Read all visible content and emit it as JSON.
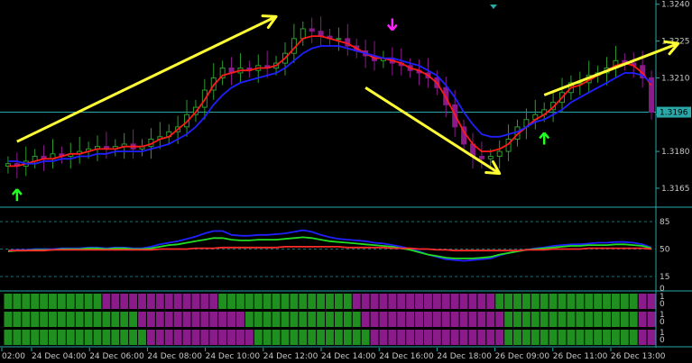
{
  "colors": {
    "background": "#000000",
    "axis": "#2aa8a8",
    "grid": "#1e6e6e",
    "tick_text": "#c8c8c8",
    "candle_up": "#2e9b2e",
    "candle_down": "#8b1a8b",
    "ma_fast": "#ff1a1a",
    "ma_slow": "#2020ff",
    "rsi_fast": "#2020ff",
    "rsi_mid": "#22dd22",
    "rsi_slow": "#ff2a2a",
    "arrow_trend": "#ffff33",
    "signal_up": "#22ff22",
    "signal_down": "#ff22ff",
    "current_price_box": "#2aa8a8",
    "bar_green": "#1f8f1f",
    "bar_purple": "#8b1a8b"
  },
  "chart_data": [
    {
      "type": "candlestick",
      "panel": "price",
      "ylim": [
        1.3158,
        1.3241
      ],
      "y_ticks": [
        "1.3240",
        "1.3225",
        "1.3210",
        "1.3195",
        "1.3180",
        "1.3165"
      ],
      "current_price_label": "1.3196",
      "x_ticks": [
        "02:00",
        "24 Dec 04:00",
        "24 Dec 06:00",
        "24 Dec 08:00",
        "24 Dec 10:00",
        "24 Dec 12:00",
        "24 Dec 14:00",
        "24 Dec 16:00",
        "24 Dec 18:00",
        "26 Dec 09:00",
        "26 Dec 11:00",
        "26 Dec 13:00"
      ],
      "series": [
        {
          "name": "close",
          "values": [
            1.3175,
            1.3174,
            1.3176,
            1.3178,
            1.3177,
            1.3179,
            1.3178,
            1.3179,
            1.318,
            1.3181,
            1.3182,
            1.3181,
            1.3182,
            1.3183,
            1.3181,
            1.3182,
            1.3185,
            1.3186,
            1.3188,
            1.319,
            1.3195,
            1.3198,
            1.3205,
            1.321,
            1.3214,
            1.3212,
            1.3214,
            1.3213,
            1.3215,
            1.3214,
            1.3216,
            1.322,
            1.3226,
            1.323,
            1.3229,
            1.3227,
            1.3226,
            1.3226,
            1.3223,
            1.3221,
            1.3219,
            1.3217,
            1.3218,
            1.3216,
            1.3215,
            1.3213,
            1.3212,
            1.321,
            1.3206,
            1.3199,
            1.319,
            1.3183,
            1.3178,
            1.3177,
            1.3178,
            1.318,
            1.3185,
            1.319,
            1.3193,
            1.3195,
            1.3197,
            1.32,
            1.3204,
            1.3208,
            1.3208,
            1.3211,
            1.3212,
            1.3214,
            1.3217,
            1.3216,
            1.3215,
            1.321,
            1.3196
          ]
        },
        {
          "name": "ma_fast",
          "values": [
            1.3174,
            1.3174,
            1.3175,
            1.3176,
            1.3177,
            1.3177,
            1.3178,
            1.3179,
            1.3179,
            1.318,
            1.3181,
            1.3181,
            1.3181,
            1.3182,
            1.3182,
            1.3182,
            1.3183,
            1.3185,
            1.3186,
            1.3189,
            1.3192,
            1.3196,
            1.3201,
            1.3207,
            1.3211,
            1.3212,
            1.3213,
            1.3213,
            1.3214,
            1.3214,
            1.3215,
            1.3218,
            1.3222,
            1.3226,
            1.3227,
            1.3227,
            1.3226,
            1.3225,
            1.3224,
            1.3222,
            1.322,
            1.3218,
            1.3218,
            1.3217,
            1.3216,
            1.3214,
            1.3213,
            1.3211,
            1.3208,
            1.3202,
            1.3195,
            1.3188,
            1.3183,
            1.318,
            1.318,
            1.3181,
            1.3183,
            1.3187,
            1.319,
            1.3193,
            1.3195,
            1.3198,
            1.3202,
            1.3206,
            1.3207,
            1.3209,
            1.3211,
            1.3213,
            1.3215,
            1.3216,
            1.3215,
            1.3212,
            1.3207
          ]
        },
        {
          "name": "ma_slow",
          "values": [
            1.3176,
            1.3176,
            1.3175,
            1.3175,
            1.3176,
            1.3176,
            1.3177,
            1.3177,
            1.3178,
            1.3178,
            1.3179,
            1.3179,
            1.318,
            1.318,
            1.318,
            1.318,
            1.3181,
            1.3182,
            1.3183,
            1.3185,
            1.3187,
            1.319,
            1.3194,
            1.3199,
            1.3203,
            1.3206,
            1.3208,
            1.3209,
            1.321,
            1.3211,
            1.3212,
            1.3214,
            1.3217,
            1.322,
            1.3222,
            1.3223,
            1.3223,
            1.3223,
            1.3222,
            1.3221,
            1.322,
            1.3219,
            1.3218,
            1.3218,
            1.3217,
            1.3216,
            1.3215,
            1.3213,
            1.3211,
            1.3207,
            1.3202,
            1.3196,
            1.3191,
            1.3187,
            1.3186,
            1.3186,
            1.3187,
            1.3188,
            1.319,
            1.3192,
            1.3193,
            1.3195,
            1.3197,
            1.32,
            1.3202,
            1.3204,
            1.3206,
            1.3208,
            1.321,
            1.3212,
            1.3212,
            1.3211,
            1.3208
          ]
        }
      ],
      "trend_arrows": [
        {
          "from": [
            1,
            1.3184
          ],
          "to": [
            30,
            1.3235
          ]
        },
        {
          "from": [
            40,
            1.3206
          ],
          "to": [
            55,
            1.3171
          ]
        },
        {
          "from": [
            60,
            1.3203
          ],
          "to": [
            75,
            1.3224
          ]
        }
      ],
      "signals": [
        {
          "dir": "up",
          "i": 1
        },
        {
          "dir": "down",
          "i": 43
        },
        {
          "dir": "up",
          "i": 60
        },
        {
          "dir": "down",
          "i": 73
        }
      ]
    },
    {
      "type": "line",
      "panel": "oscillator",
      "ylim": [
        0,
        100
      ],
      "y_ticks": [
        "85",
        "50",
        "15",
        "0"
      ],
      "dashed_levels": [
        85,
        50,
        15
      ],
      "series": [
        {
          "name": "fast",
          "values": [
            48,
            49,
            49,
            50,
            50,
            50,
            51,
            51,
            51,
            52,
            52,
            51,
            52,
            52,
            51,
            51,
            53,
            56,
            58,
            60,
            63,
            66,
            70,
            73,
            73,
            68,
            67,
            67,
            68,
            68,
            69,
            70,
            72,
            74,
            72,
            68,
            65,
            63,
            62,
            61,
            60,
            58,
            57,
            55,
            53,
            50,
            47,
            43,
            40,
            37,
            36,
            35,
            36,
            37,
            38,
            42,
            45,
            47,
            49,
            51,
            52,
            54,
            55,
            56,
            56,
            57,
            58,
            58,
            59,
            59,
            58,
            56,
            52
          ]
        },
        {
          "name": "mid",
          "values": [
            47,
            48,
            48,
            49,
            49,
            49,
            50,
            50,
            50,
            51,
            51,
            50,
            51,
            51,
            50,
            50,
            51,
            53,
            55,
            56,
            58,
            60,
            62,
            64,
            64,
            62,
            61,
            61,
            62,
            62,
            62,
            63,
            64,
            65,
            64,
            62,
            60,
            59,
            58,
            57,
            56,
            55,
            54,
            53,
            51,
            49,
            46,
            43,
            41,
            39,
            38,
            38,
            38,
            39,
            40,
            43,
            45,
            47,
            49,
            50,
            51,
            52,
            53,
            54,
            54,
            55,
            55,
            55,
            56,
            56,
            55,
            54,
            51
          ]
        },
        {
          "name": "slow",
          "values": [
            48,
            48,
            48,
            48,
            48,
            49,
            49,
            49,
            49,
            49,
            49,
            49,
            49,
            49,
            49,
            49,
            49,
            50,
            50,
            50,
            50,
            51,
            51,
            51,
            52,
            52,
            52,
            52,
            52,
            52,
            52,
            53,
            53,
            53,
            53,
            53,
            53,
            53,
            52,
            52,
            52,
            52,
            52,
            51,
            51,
            51,
            50,
            50,
            49,
            49,
            48,
            48,
            48,
            48,
            48,
            48,
            48,
            48,
            49,
            49,
            49,
            50,
            50,
            50,
            50,
            51,
            51,
            51,
            51,
            51,
            51,
            51,
            50
          ]
        }
      ]
    },
    {
      "type": "heatmap",
      "panel": "signal-bars",
      "rows": [
        {
          "y_ticks": [
            "1",
            "0"
          ],
          "states": "0000000000011111111111110000000000000001111111111111111000000000000000011"
        },
        {
          "y_ticks": [
            "1",
            "0"
          ],
          "states": "0000000000000001111111111110000000000000111111111111111100000000000000011"
        },
        {
          "y_ticks": [
            "1",
            "0"
          ],
          "states": "0000000000000000111111111111000000000000011111111111111100000000000000011"
        }
      ]
    }
  ]
}
